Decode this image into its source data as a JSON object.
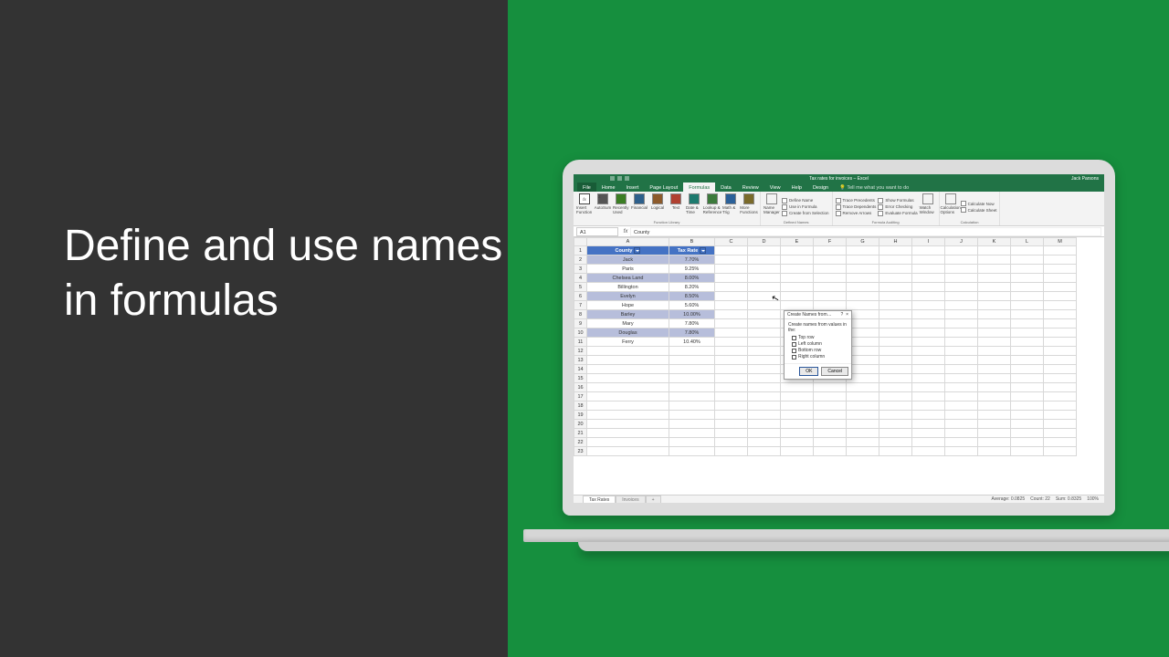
{
  "heading": "Define and use names in formulas",
  "titlebar": {
    "center": "Tax rates for invoices – Excel",
    "user": "Jack Parsons"
  },
  "tabs": {
    "file": "File",
    "items": [
      "Home",
      "Insert",
      "Page Layout",
      "Formulas",
      "Data",
      "Review",
      "View",
      "Help",
      "Design"
    ],
    "active_index": 3,
    "tellme": "Tell me what you want to do"
  },
  "ribbon": {
    "fx_label": "fx",
    "insert_fn": "Insert Function",
    "library": {
      "items": [
        "AutoSum",
        "Recently Used",
        "Financial",
        "Logical",
        "Text",
        "Date & Time",
        "Lookup & Reference",
        "Math & Trig",
        "More Functions"
      ],
      "label": "Function Library"
    },
    "defined": {
      "name_manager": "Name Manager",
      "items": [
        "Define Name",
        "Use in Formula",
        "Create from Selection"
      ],
      "label": "Defined Names"
    },
    "auditing": {
      "items": [
        "Trace Precedents",
        "Trace Dependents",
        "Remove Arrows",
        "Show Formulas",
        "Error Checking",
        "Evaluate Formula"
      ],
      "watch": "Watch Window",
      "label": "Formula Auditing"
    },
    "calc": {
      "options": "Calculation Options",
      "items": [
        "Calculate Now",
        "Calculate Sheet"
      ],
      "label": "Calculation"
    }
  },
  "formulabar": {
    "namebox": "A1",
    "fx": "fx",
    "content": "County"
  },
  "columns": [
    "A",
    "B",
    "C",
    "D",
    "E",
    "F",
    "G",
    "H",
    "I",
    "J",
    "K",
    "L",
    "M"
  ],
  "chart_data": {
    "type": "table",
    "headers": [
      "County",
      "Tax Rate"
    ],
    "rows": [
      {
        "county": "Jack",
        "rate": "7.70%"
      },
      {
        "county": "Paris",
        "rate": "9.25%"
      },
      {
        "county": "Chelsea Land",
        "rate": "8.00%"
      },
      {
        "county": "Billington",
        "rate": "8.20%"
      },
      {
        "county": "Evelyn",
        "rate": "8.50%"
      },
      {
        "county": "Hope",
        "rate": "5.60%"
      },
      {
        "county": "Barley",
        "rate": "10.00%"
      },
      {
        "county": "Mary",
        "rate": "7.80%"
      },
      {
        "county": "Douglas",
        "rate": "7.80%"
      },
      {
        "county": "Ferry",
        "rate": "10.40%"
      }
    ]
  },
  "dialog": {
    "title": "Create Names from…",
    "help": "?",
    "close": "×",
    "prompt": "Create names from values in the:",
    "options": [
      "Top row",
      "Left column",
      "Bottom row",
      "Right column"
    ],
    "ok": "OK",
    "cancel": "Cancel"
  },
  "sheets": {
    "active": "Tax Rates",
    "inactive": "Invoices",
    "add": "+"
  },
  "status": {
    "avg": "Average: 0.0825",
    "count": "Count: 22",
    "sum": "Sum: 0.8325",
    "zoom": "100%"
  }
}
